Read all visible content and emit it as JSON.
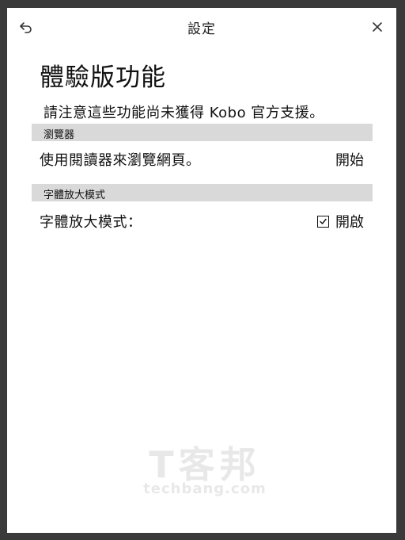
{
  "topbar": {
    "title": "設定",
    "back_icon": "back-arrow-icon",
    "close_icon": "close-icon"
  },
  "page": {
    "heading": "體驗版功能",
    "notice": "請注意這些功能尚未獲得 Kobo 官方支援。"
  },
  "sections": [
    {
      "header": "瀏覽器",
      "row_label": "使用閱讀器來瀏覽網頁。",
      "action_label": "開始"
    },
    {
      "header": "字體放大模式",
      "row_label": "字體放大模式：",
      "toggle_label": "開啟",
      "toggle_checked": true
    }
  ],
  "watermark": {
    "logo_text": "T客邦",
    "url_text": "techbang.com"
  },
  "colors": {
    "background": "#3a3a3a",
    "panel": "#ffffff",
    "section_header_bg": "#d9d9d9",
    "text": "#111111"
  }
}
